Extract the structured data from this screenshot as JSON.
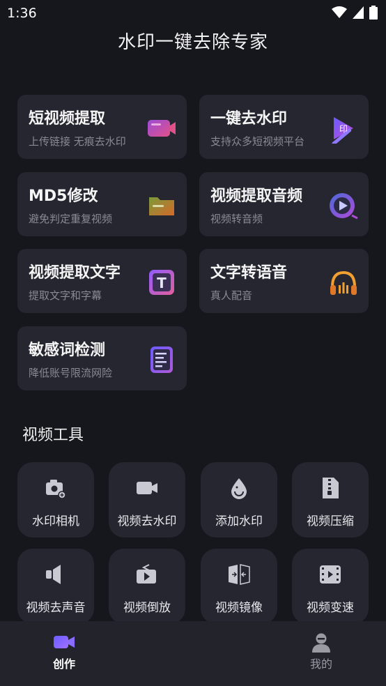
{
  "status": {
    "time": "1:36"
  },
  "app": {
    "title": "水印一键去除专家"
  },
  "features": [
    {
      "title": "短视频提取",
      "subtitle": "上传链接 无痕去水印",
      "icon": "video-camera-icon"
    },
    {
      "title": "一键去水印",
      "subtitle": "支持众多短视频平台",
      "icon": "watermark-eraser-icon",
      "icon_text": "印"
    },
    {
      "title": "MD5修改",
      "subtitle": "避免判定重复视频",
      "icon": "folder-icon"
    },
    {
      "title": "视频提取音频",
      "subtitle": "视频转音频",
      "icon": "play-circle-icon"
    },
    {
      "title": "视频提取文字",
      "subtitle": "提取文字和字幕",
      "icon": "text-t-icon",
      "icon_text": "T"
    },
    {
      "title": "文字转语音",
      "subtitle": "真人配音",
      "icon": "headphones-icon"
    },
    {
      "title": "敏感词检测",
      "subtitle": "降低账号限流网险",
      "icon": "document-lines-icon"
    }
  ],
  "tools_section": {
    "title": "视频工具"
  },
  "tools": [
    {
      "label": "水印相机",
      "icon": "camera-icon"
    },
    {
      "label": "视频去水印",
      "icon": "video-icon"
    },
    {
      "label": "添加水印",
      "icon": "water-drop-icon"
    },
    {
      "label": "视频压缩",
      "icon": "zip-file-icon"
    },
    {
      "label": "视频去声音",
      "icon": "speaker-mute-icon"
    },
    {
      "label": "视频倒放",
      "icon": "reverse-play-icon"
    },
    {
      "label": "视频镜像",
      "icon": "mirror-icon"
    },
    {
      "label": "视频变速",
      "icon": "film-speed-icon"
    }
  ],
  "nav": {
    "create": {
      "label": "创作",
      "active": true,
      "color": "#7b6cff"
    },
    "mine": {
      "label": "我的",
      "active": false,
      "color": "#9a9aa3"
    }
  },
  "colors": {
    "background": "#16161d",
    "card": "#262630",
    "accent": "#7b6cff"
  }
}
